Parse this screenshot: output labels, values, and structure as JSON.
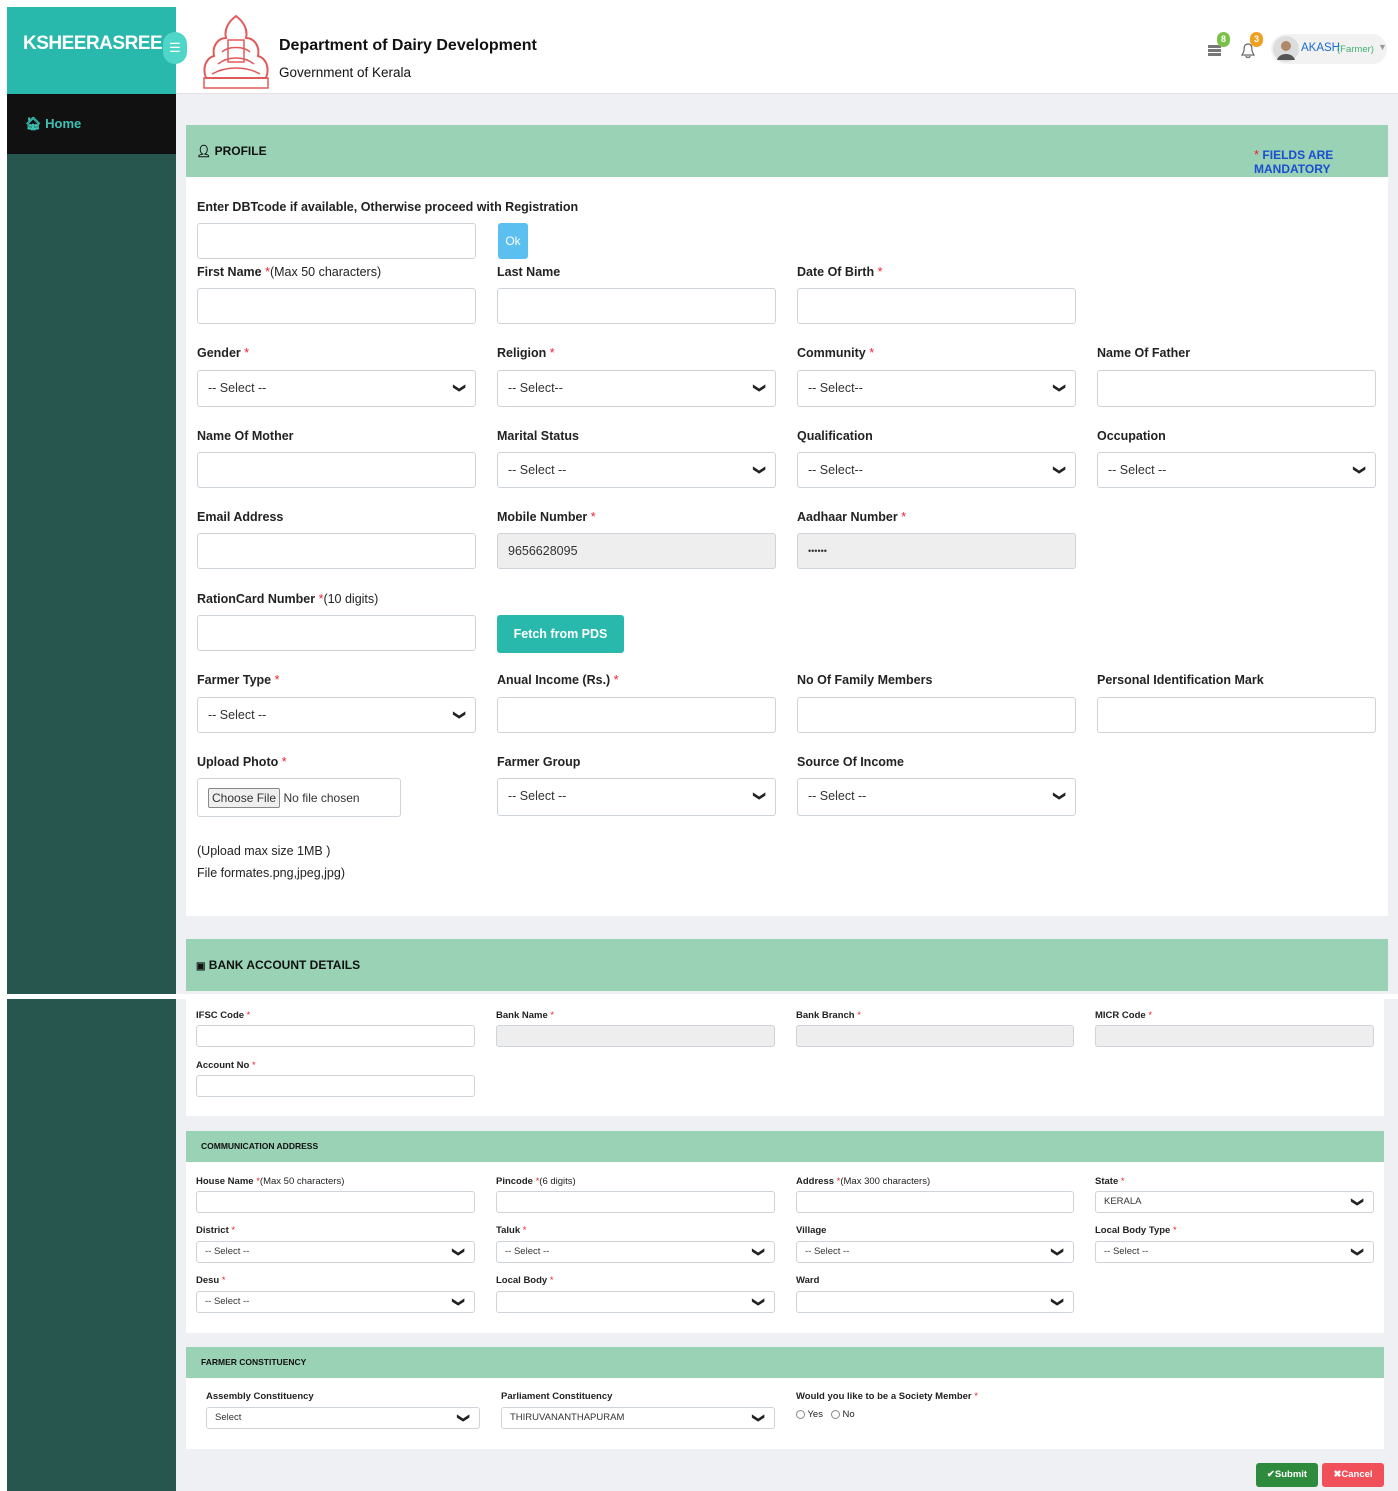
{
  "app": {
    "brand": "KSHEERASREE",
    "dept_title": "Department of Dairy Development",
    "dept_sub": "Government of Kerala"
  },
  "topbar": {
    "msg_count": "8",
    "notif_count": "3",
    "user_name": "AKASH",
    "user_role": "(Farmer)"
  },
  "nav": {
    "home": "Home"
  },
  "profile": {
    "title": "PROFILE",
    "mandatory_star": "*",
    "mandatory": "FIELDS ARE MANDATORY",
    "dbt_label": "Enter DBTcode if available, Otherwise proceed with Registration",
    "ok": "Ok",
    "first_name": "First Name",
    "first_name_hint": "(Max 50 characters)",
    "last_name": "Last Name",
    "dob": "Date Of Birth",
    "gender": "Gender",
    "gender_val": "-- Select --",
    "religion": "Religion",
    "religion_val": "-- Select--",
    "community": "Community",
    "community_val": "-- Select--",
    "father": "Name Of Father",
    "mother": "Name Of Mother",
    "marital": "Marital Status",
    "marital_val": "-- Select --",
    "qualification": "Qualification",
    "qualification_val": "-- Select--",
    "occupation": "Occupation",
    "occupation_val": "-- Select --",
    "email": "Email Address",
    "mobile": "Mobile Number",
    "mobile_val": "9656628095",
    "aadhaar": "Aadhaar Number",
    "aadhaar_val": "••••••",
    "ration": "RationCard Number",
    "ration_hint": "(10 digits)",
    "fetch": "Fetch from PDS",
    "farmer_type": "Farmer Type",
    "farmer_type_val": "-- Select --",
    "income": "Anual Income (Rs.)",
    "family": "No Of Family Members",
    "mark": "Personal Identification Mark",
    "photo": "Upload Photo",
    "choose": "Choose File",
    "no_file": "No file chosen",
    "group": "Farmer Group",
    "group_val": "-- Select --",
    "source": "Source Of Income",
    "source_val": "-- Select --",
    "upload_note1": "(Upload max size 1MB )",
    "upload_note2": "File formates.png,jpeg,jpg)"
  },
  "bank": {
    "title": "BANK ACCOUNT DETAILS",
    "ifsc": "IFSC Code",
    "bank_name": "Bank Name",
    "branch": "Bank Branch",
    "micr": "MICR Code",
    "account": "Account No"
  },
  "address": {
    "title": "COMMUNICATION ADDRESS",
    "house": "House Name",
    "house_hint": "(Max 50 characters)",
    "pincode": "Pincode",
    "pincode_hint": "(6 digits)",
    "addr": "Address",
    "addr_hint": "(Max 300 characters)",
    "state": "State",
    "state_val": "KERALA",
    "district": "District",
    "district_val": "-- Select --",
    "taluk": "Taluk",
    "taluk_val": "-- Select --",
    "village": "Village",
    "village_val": "-- Select --",
    "lbt": "Local Body Type",
    "lbt_val": "-- Select --",
    "desu": "Desu",
    "desu_val": "-- Select --",
    "local_body": "Local Body",
    "ward": "Ward"
  },
  "constituency": {
    "title": "FARMER CONSTITUENCY",
    "assembly": "Assembly Constituency",
    "assembly_val": "Select",
    "parliament": "Parliament Constituency",
    "parliament_val": "THIRUVANANTHAPURAM",
    "society": "Would you like to be a Society Member",
    "yes": "Yes",
    "no": "No"
  },
  "actions": {
    "submit": "Submit",
    "cancel": "Cancel"
  },
  "colors": {
    "brand": "#29b9ac",
    "header": "#99d2b5",
    "sidebar": "#27564f",
    "submit": "#2e8b3e",
    "cancel": "#f0505a"
  }
}
